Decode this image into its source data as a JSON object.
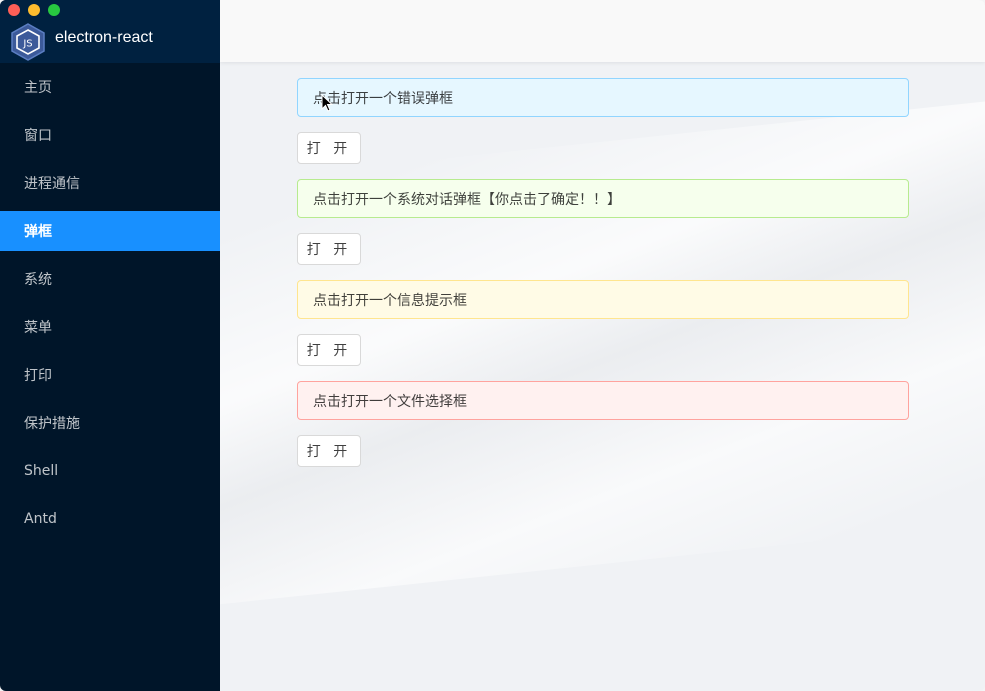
{
  "app": {
    "title": "electron-react",
    "logo_icon": "nodejs-logo-icon"
  },
  "sidebar": {
    "items": [
      {
        "label": "主页"
      },
      {
        "label": "窗口"
      },
      {
        "label": "进程通信"
      },
      {
        "label": "弹框",
        "active": true
      },
      {
        "label": "系统"
      },
      {
        "label": "菜单"
      },
      {
        "label": "打印"
      },
      {
        "label": "保护措施"
      },
      {
        "label": "Shell"
      },
      {
        "label": "Antd"
      }
    ]
  },
  "main": {
    "sections": [
      {
        "type": "info",
        "alert_text": "点击打开一个错误弹框",
        "button_label": "打 开"
      },
      {
        "type": "success",
        "alert_text": "点击打开一个系统对话弹框【你点击了确定！！】",
        "button_label": "打 开"
      },
      {
        "type": "warning",
        "alert_text": "点击打开一个信息提示框",
        "button_label": "打 开"
      },
      {
        "type": "error",
        "alert_text": "点击打开一个文件选择框",
        "button_label": "打 开"
      }
    ]
  },
  "colors": {
    "sidebar_bg": "#001529",
    "header_bg": "#002140",
    "active_item": "#1890ff"
  }
}
